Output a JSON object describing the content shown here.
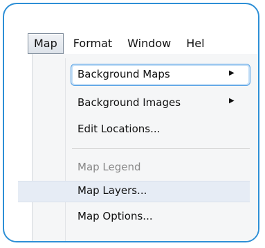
{
  "menubar": {
    "items": [
      "Map",
      "Format",
      "Window",
      "Hel"
    ]
  },
  "menu": {
    "items": [
      {
        "label": "Background Maps",
        "submenu": true,
        "state": "focused"
      },
      {
        "label": "Background Images",
        "submenu": true,
        "state": "normal"
      },
      {
        "label": "Edit Locations...",
        "submenu": false,
        "state": "normal"
      },
      {
        "label": "Map Legend",
        "submenu": false,
        "state": "disabled"
      },
      {
        "label": "Map Layers...",
        "submenu": false,
        "state": "hover"
      },
      {
        "label": "Map Options...",
        "submenu": false,
        "state": "normal"
      }
    ]
  },
  "icons": {
    "submenu_arrow": "right-triangle-icon"
  },
  "colors": {
    "frame": "#2d8fd6",
    "focus_border": "#5aa3e6",
    "hover_background": "#e6ecf5",
    "disabled_text": "#888888"
  }
}
